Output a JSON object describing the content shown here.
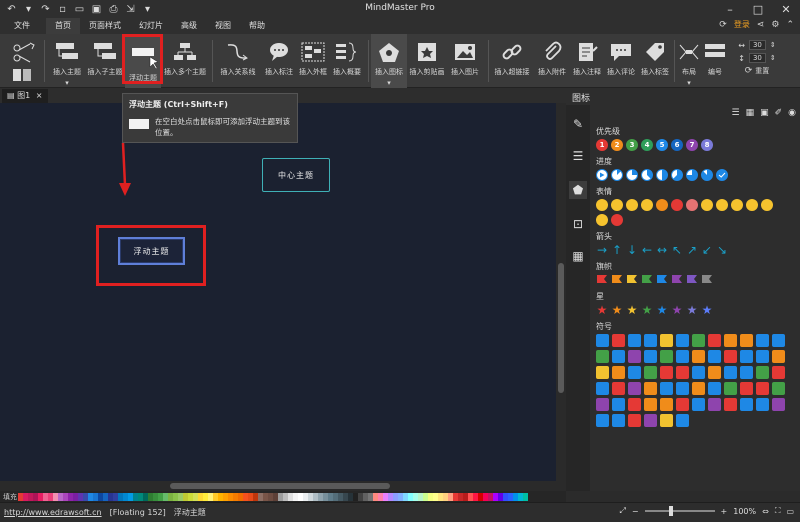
{
  "app": {
    "title": "MindMaster Pro"
  },
  "quick_access": [
    "undo-icon",
    "undo-dropdown-icon",
    "redo-icon",
    "new-file-icon",
    "open-folder-icon",
    "save-icon",
    "print-icon",
    "export-icon",
    "more-icon"
  ],
  "menu": {
    "file": "文件",
    "items": [
      "首页",
      "页面样式",
      "幻灯片",
      "高级",
      "视图",
      "帮助"
    ],
    "active_index": 0,
    "login": "登录"
  },
  "ribbon": {
    "insert_topic": "插入主题",
    "insert_subtopic": "插入子主题",
    "floating_topic": "浮动主题",
    "multiple_topics": "插入多个主题",
    "relationship": "插入关系线",
    "callout": "插入标注",
    "boundary": "插入外框",
    "summary": "插入概要",
    "icon": "插入图标",
    "clipart": "插入剪贴画",
    "image": "插入图片",
    "hyperlink": "插入超链接",
    "attachment": "插入附件",
    "note": "插入注释",
    "comment": "插入评论",
    "tag": "插入标签",
    "layout": "布局",
    "numbering": "编号",
    "spin1": "30",
    "spin2": "30",
    "reset": "重置"
  },
  "doc_tab": {
    "label": "图1"
  },
  "canvas": {
    "center_topic": "中心主题",
    "floating_topic": "浮动主题"
  },
  "tooltip": {
    "title": "浮动主题 (Ctrl+Shift+F)",
    "text": "在空白处点击鼠标即可添加浮动主题到该位置。"
  },
  "panel": {
    "title": "图标",
    "sections": {
      "priority": "优先级",
      "progress": "进度",
      "expression": "表情",
      "arrow": "箭头",
      "flag": "旗帜",
      "star": "星",
      "symbol": "符号"
    },
    "priority_values": [
      "1",
      "2",
      "3",
      "4",
      "5",
      "6",
      "7",
      "8"
    ],
    "priority_colors": [
      "#e53935",
      "#f08c1a",
      "#43a047",
      "#2e9e5a",
      "#1e88e5",
      "#1565c0",
      "#8e44ad",
      "#7a7ad8"
    ],
    "flag_colors": [
      "#e53935",
      "#f08c1a",
      "#f2c230",
      "#43a047",
      "#1e88e5",
      "#8e44ad",
      "#7e57c2",
      "#888888"
    ],
    "star_colors": [
      "#e53935",
      "#f08c1a",
      "#f2c230",
      "#43a047",
      "#1e88e5",
      "#8e44ad",
      "#7a7ad8",
      "#5c7cfa"
    ],
    "symbol_colors": [
      "#1e88e5",
      "#e53935",
      "#1e88e5",
      "#1e88e5",
      "#f2c230",
      "#1e88e5",
      "#43a047",
      "#e53935",
      "#f08c1a",
      "#f08c1a",
      "#1e88e5",
      "#1e88e5",
      "#43a047",
      "#1e88e5",
      "#8e44ad",
      "#1e88e5",
      "#43a047",
      "#1e88e5",
      "#f08c1a",
      "#1e88e5",
      "#e53935",
      "#1e88e5",
      "#1e88e5",
      "#f08c1a",
      "#f2c230",
      "#f08c1a",
      "#1e88e5",
      "#43a047",
      "#e53935",
      "#e53935",
      "#1e88e5",
      "#f08c1a",
      "#1e88e5",
      "#1e88e5",
      "#43a047",
      "#e53935",
      "#1e88e5",
      "#e53935",
      "#8e44ad",
      "#f08c1a",
      "#1e88e5",
      "#1e88e5",
      "#f08c1a",
      "#1e88e5",
      "#43a047",
      "#e53935",
      "#e53935",
      "#43a047",
      "#8e44ad",
      "#1e88e5",
      "#e53935",
      "#f08c1a",
      "#f08c1a",
      "#e53935",
      "#1e88e5",
      "#8e44ad",
      "#e53935",
      "#1e88e5",
      "#1e88e5",
      "#8e44ad",
      "#1e88e5",
      "#1e88e5",
      "#e53935",
      "#8e44ad",
      "#f2c230",
      "#1e88e5"
    ]
  },
  "palette": {
    "label": "填充",
    "colors": [
      "#e53935",
      "#d81b60",
      "#c2185b",
      "#ad1457",
      "#e91e63",
      "#f06292",
      "#ec407a",
      "#f48fb1",
      "#ba68c8",
      "#ab47bc",
      "#8e24aa",
      "#7b1fa2",
      "#5e35b1",
      "#3949ab",
      "#1e88e5",
      "#1976d2",
      "#0d47a1",
      "#1565c0",
      "#283593",
      "#303f9f",
      "#0277bd",
      "#0288d1",
      "#039be5",
      "#00838f",
      "#00897b",
      "#00695c",
      "#2e7d32",
      "#388e3c",
      "#43a047",
      "#66bb6a",
      "#7cb342",
      "#8bc34a",
      "#9ccc65",
      "#c0ca33",
      "#cddc39",
      "#d4e157",
      "#fdd835",
      "#ffeb3b",
      "#fff176",
      "#ffca28",
      "#ffb300",
      "#ffa000",
      "#fb8c00",
      "#f57c00",
      "#ef6c00",
      "#f4511e",
      "#e64a19",
      "#bf360c",
      "#8d6e63",
      "#795548",
      "#6d4c41",
      "#5d4037",
      "#9e9e9e",
      "#bdbdbd",
      "#e0e0e0",
      "#f5f5f5",
      "#ffffff",
      "#eceff1",
      "#cfd8dc",
      "#b0bec5",
      "#90a4ae",
      "#78909c",
      "#607d8b",
      "#546e7a",
      "#455a64",
      "#37474f",
      "#263238",
      "#212121",
      "#424242",
      "#616161",
      "#757575",
      "#ff8a80",
      "#ff80ab",
      "#ea80fc",
      "#b388ff",
      "#8c9eff",
      "#82b1ff",
      "#80d8ff",
      "#84ffff",
      "#a7ffeb",
      "#b9f6ca",
      "#ccff90",
      "#f4ff81",
      "#ffff8d",
      "#ffe57f",
      "#ffd180",
      "#ff9e80",
      "#e53935",
      "#c62828",
      "#b71c1c",
      "#ff5252",
      "#ff1744",
      "#d50000",
      "#f50057",
      "#c51162",
      "#aa00ff",
      "#6200ea",
      "#304ffe",
      "#2962ff",
      "#0091ea",
      "#00b8d4",
      "#00bfa5"
    ]
  },
  "status": {
    "url": "http://www.edrawsoft.cn",
    "floating": "[Floating 152]",
    "selection": "浮动主题",
    "zoom": "100%"
  }
}
